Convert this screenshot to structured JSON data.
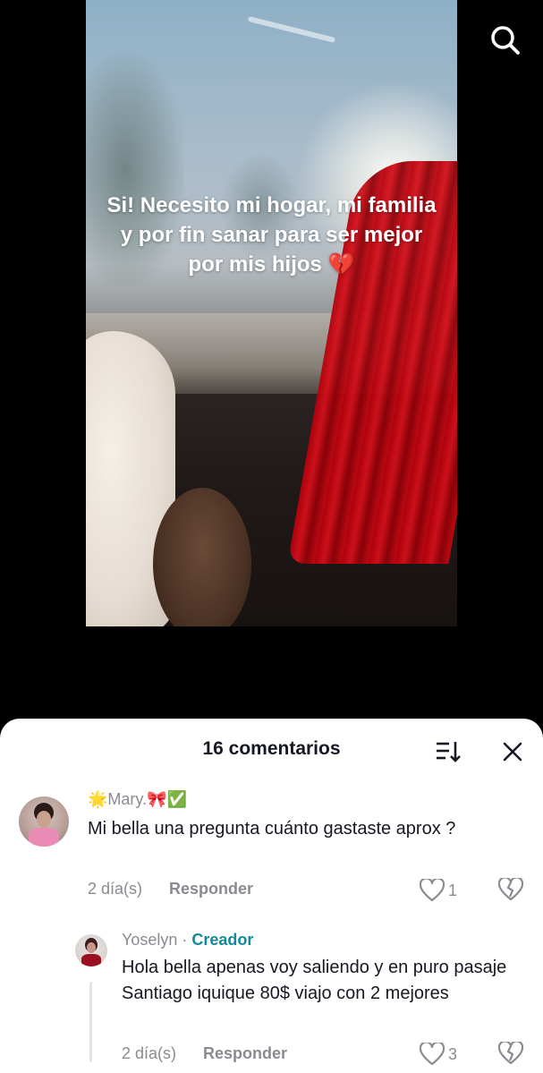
{
  "video": {
    "caption": "Si! Necesito mi hogar, mi familia y por fin sanar para ser mejor por mis hijos 💔"
  },
  "comments_sheet": {
    "title": "16 comentarios",
    "comments": [
      {
        "username": "🌟Mary.🎀✅",
        "text": "Mi bella una pregunta cuánto gastaste aprox ?",
        "date": "2 día(s)",
        "reply_label": "Responder",
        "likes": "1"
      },
      {
        "username": "Yoselyn",
        "separator": " · ",
        "creator_label": "Creador",
        "text": "Hola bella apenas voy saliendo y en puro pasaje Santiago iquique 80$ viajo con 2 mejores",
        "date": "2 día(s)",
        "reply_label": "Responder",
        "likes": "3"
      }
    ]
  },
  "icons": {
    "search": "search-icon",
    "sort": "sort-icon",
    "close": "close-icon",
    "like": "heart-outline-icon",
    "dislike": "broken-heart-icon"
  },
  "colors": {
    "accent_creator": "#138a9a",
    "secondary_text": "#8a8b91",
    "primary_text": "#161823"
  }
}
